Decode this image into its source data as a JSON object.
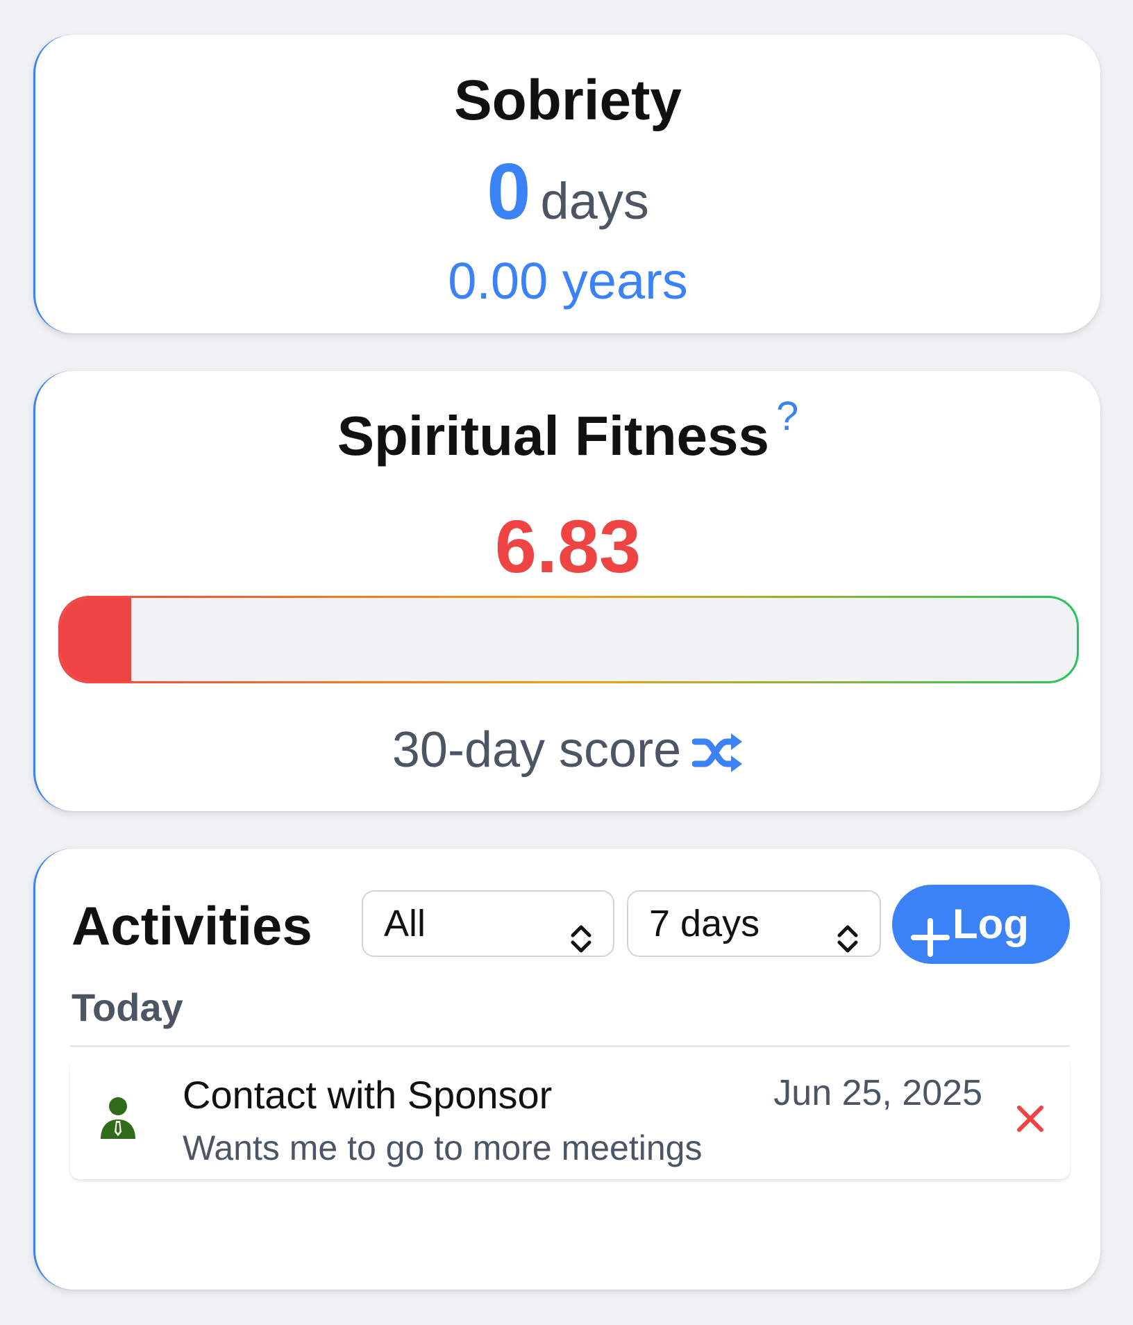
{
  "sobriety": {
    "title": "Sobriety",
    "days_value": "0",
    "days_unit": "days",
    "years_text": "0.00 years"
  },
  "fitness": {
    "title": "Spiritual Fitness",
    "help_symbol": "?",
    "score": "6.83",
    "score_fraction": 0.07,
    "score_label": "30-day score",
    "score_color": "#ef4444",
    "bar_gradient": [
      "#ef4444",
      "#f59e0b",
      "#22c55e"
    ],
    "toggle_icon": "shuffle-icon"
  },
  "activities": {
    "title": "Activities",
    "type_filter": {
      "selected": "All",
      "icon": "chevron-up-down-icon"
    },
    "range_filter": {
      "selected": "7 days",
      "icon": "chevron-up-down-icon"
    },
    "log_button": {
      "label": "Log",
      "icon": "plus-icon",
      "color": "#3b82f6"
    },
    "groups": [
      {
        "label": "Today",
        "items": [
          {
            "icon": "person-with-tie-icon",
            "icon_color": "#2f6b1a",
            "name": "Contact with Sponsor",
            "note": "Wants me to go to more meetings",
            "date": "Jun 25, 2025",
            "delete_icon": "close-icon",
            "delete_color": "#ef4444"
          }
        ]
      }
    ]
  },
  "colors": {
    "accent": "#3b82f6",
    "background": "#f0f1f4",
    "text_secondary": "#4b5563"
  }
}
